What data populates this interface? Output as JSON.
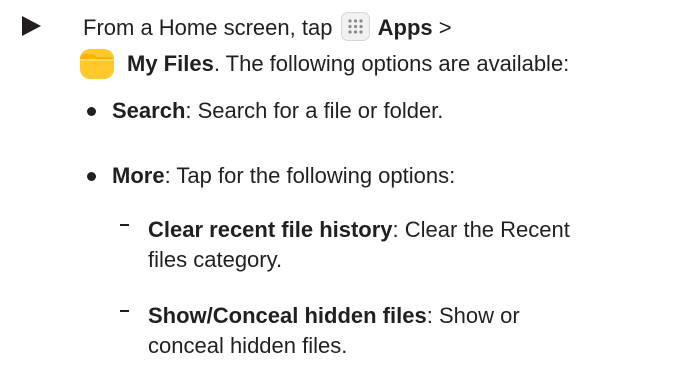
{
  "step": {
    "prefix": "From a Home screen, tap ",
    "apps_label": "Apps",
    "separator": " >",
    "my_files_label": "My Files",
    "suffix": ". The following options are available:"
  },
  "bullets": [
    {
      "term": "Search",
      "description": ": Search for a file or folder."
    },
    {
      "term": "More",
      "description": ": Tap for the following options:"
    }
  ],
  "sub_items": [
    {
      "term": "Clear recent file history",
      "description_line1": ": Clear the Recent",
      "description_line2": "files category."
    },
    {
      "term": "Show/Conceal hidden files",
      "description_line1": ": Show or",
      "description_line2": "conceal hidden files."
    }
  ],
  "icons": {
    "step_marker": "right-triangle-arrow",
    "apps": "apps-grid-icon",
    "my_files": "yellow-folder-icon"
  },
  "colors": {
    "text": "#231f20",
    "apps_icon_bg": "#f1f1f1",
    "folder_yellow": "#ffc82c"
  }
}
